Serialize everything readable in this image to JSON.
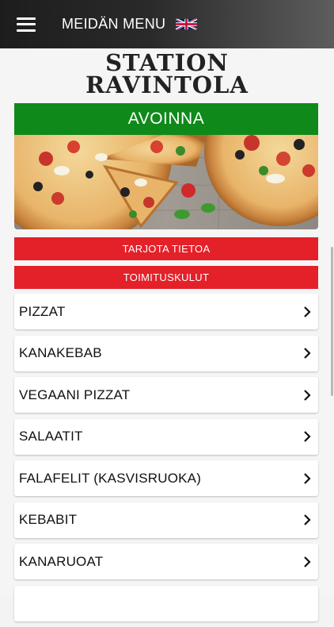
{
  "header": {
    "title": "MEIDÄN MENU",
    "language_flag": "uk-flag-icon"
  },
  "logo": {
    "line1": "STATION",
    "line2": "RAVINTOLA"
  },
  "status": {
    "label": "AVOINNA",
    "color": "#0f8a1a"
  },
  "buttons": {
    "offer_info": "TARJOTA TIETOA",
    "delivery_costs": "TOIMITUSKULUT",
    "color": "#e42029"
  },
  "categories": [
    {
      "label": "PIZZAT"
    },
    {
      "label": "KANAKEBAB"
    },
    {
      "label": "VEGAANI PIZZAT"
    },
    {
      "label": "SALAATIT"
    },
    {
      "label": "FALAFELIT (KASVISRUOKA)"
    },
    {
      "label": "KEBABIT"
    },
    {
      "label": "KANARUOAT"
    },
    {
      "label": ""
    }
  ],
  "icons": {
    "menu": "hamburger-menu-icon",
    "chevron": "chevron-right-icon"
  }
}
